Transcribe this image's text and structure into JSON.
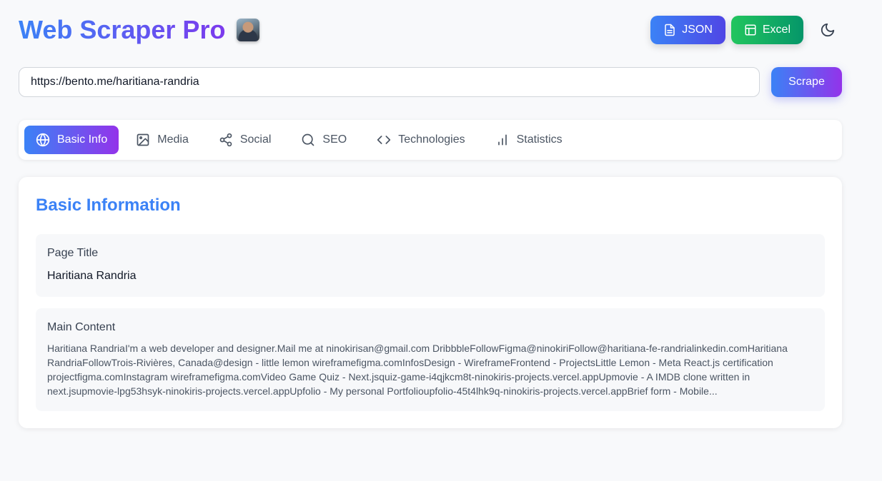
{
  "app": {
    "title": "Web Scraper Pro"
  },
  "header": {
    "json_label": "JSON",
    "excel_label": "Excel"
  },
  "search": {
    "url_value": "https://bento.me/haritiana-randria",
    "scrape_label": "Scrape"
  },
  "tabs": [
    {
      "label": "Basic Info",
      "icon": "globe-icon",
      "active": true
    },
    {
      "label": "Media",
      "icon": "image-icon",
      "active": false
    },
    {
      "label": "Social",
      "icon": "share-icon",
      "active": false
    },
    {
      "label": "SEO",
      "icon": "search-icon",
      "active": false
    },
    {
      "label": "Technologies",
      "icon": "code-icon",
      "active": false
    },
    {
      "label": "Statistics",
      "icon": "bar-chart-icon",
      "active": false
    }
  ],
  "basic_info": {
    "heading": "Basic Information",
    "page_title_label": "Page Title",
    "page_title_value": "Haritiana Randria",
    "main_content_label": "Main Content",
    "main_content_value": "Haritiana RandriaI'm a web developer and designer.Mail me at ninokirisan@gmail.com DribbbleFollowFigma@ninokiriFollow@haritiana-fe-randrialinkedin.comHaritiana RandriaFollowTrois-Rivières, Canada@design - little lemon wireframefigma.comInfosDesign - WireframeFrontend - ProjectsLittle Lemon - Meta React.js certification projectfigma.comInstagram wireframefigma.comVideo Game Quiz - Next.jsquiz-game-i4qjkcm8t-ninokiris-projects.vercel.appUpmovie - A IMDB clone written in next.jsupmovie-lpg53hsyk-ninokiris-projects.vercel.appUpfolio - My personal Portfolioupfolio-45t4lhk9q-ninokiris-projects.vercel.appBrief form - Mobile..."
  },
  "colors": {
    "brand_gradient_start": "#3b82f6",
    "brand_gradient_end": "#7c3aed",
    "excel_green": "#22c55e",
    "heading_blue": "#3b82f6"
  }
}
